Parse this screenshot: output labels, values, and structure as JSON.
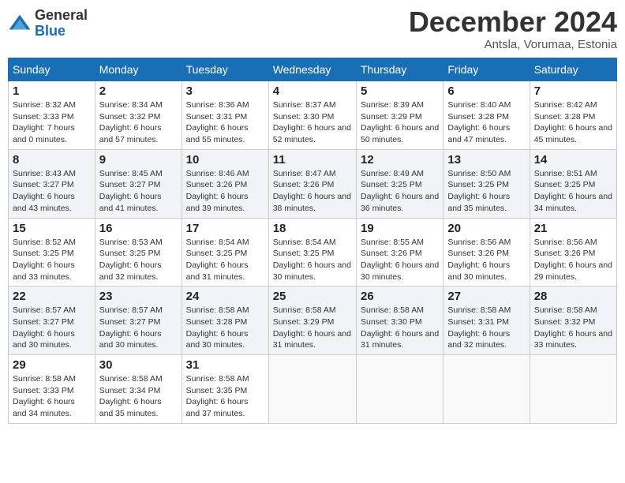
{
  "header": {
    "logo_general": "General",
    "logo_blue": "Blue",
    "month_title": "December 2024",
    "location": "Antsla, Vorumaa, Estonia"
  },
  "days_of_week": [
    "Sunday",
    "Monday",
    "Tuesday",
    "Wednesday",
    "Thursday",
    "Friday",
    "Saturday"
  ],
  "weeks": [
    [
      {
        "day": "1",
        "sunrise": "8:32 AM",
        "sunset": "3:33 PM",
        "daylight": "7 hours and 0 minutes."
      },
      {
        "day": "2",
        "sunrise": "8:34 AM",
        "sunset": "3:32 PM",
        "daylight": "6 hours and 57 minutes."
      },
      {
        "day": "3",
        "sunrise": "8:36 AM",
        "sunset": "3:31 PM",
        "daylight": "6 hours and 55 minutes."
      },
      {
        "day": "4",
        "sunrise": "8:37 AM",
        "sunset": "3:30 PM",
        "daylight": "6 hours and 52 minutes."
      },
      {
        "day": "5",
        "sunrise": "8:39 AM",
        "sunset": "3:29 PM",
        "daylight": "6 hours and 50 minutes."
      },
      {
        "day": "6",
        "sunrise": "8:40 AM",
        "sunset": "3:28 PM",
        "daylight": "6 hours and 47 minutes."
      },
      {
        "day": "7",
        "sunrise": "8:42 AM",
        "sunset": "3:28 PM",
        "daylight": "6 hours and 45 minutes."
      }
    ],
    [
      {
        "day": "8",
        "sunrise": "8:43 AM",
        "sunset": "3:27 PM",
        "daylight": "6 hours and 43 minutes."
      },
      {
        "day": "9",
        "sunrise": "8:45 AM",
        "sunset": "3:27 PM",
        "daylight": "6 hours and 41 minutes."
      },
      {
        "day": "10",
        "sunrise": "8:46 AM",
        "sunset": "3:26 PM",
        "daylight": "6 hours and 39 minutes."
      },
      {
        "day": "11",
        "sunrise": "8:47 AM",
        "sunset": "3:26 PM",
        "daylight": "6 hours and 38 minutes."
      },
      {
        "day": "12",
        "sunrise": "8:49 AM",
        "sunset": "3:25 PM",
        "daylight": "6 hours and 36 minutes."
      },
      {
        "day": "13",
        "sunrise": "8:50 AM",
        "sunset": "3:25 PM",
        "daylight": "6 hours and 35 minutes."
      },
      {
        "day": "14",
        "sunrise": "8:51 AM",
        "sunset": "3:25 PM",
        "daylight": "6 hours and 34 minutes."
      }
    ],
    [
      {
        "day": "15",
        "sunrise": "8:52 AM",
        "sunset": "3:25 PM",
        "daylight": "6 hours and 33 minutes."
      },
      {
        "day": "16",
        "sunrise": "8:53 AM",
        "sunset": "3:25 PM",
        "daylight": "6 hours and 32 minutes."
      },
      {
        "day": "17",
        "sunrise": "8:54 AM",
        "sunset": "3:25 PM",
        "daylight": "6 hours and 31 minutes."
      },
      {
        "day": "18",
        "sunrise": "8:54 AM",
        "sunset": "3:25 PM",
        "daylight": "6 hours and 30 minutes."
      },
      {
        "day": "19",
        "sunrise": "8:55 AM",
        "sunset": "3:26 PM",
        "daylight": "6 hours and 30 minutes."
      },
      {
        "day": "20",
        "sunrise": "8:56 AM",
        "sunset": "3:26 PM",
        "daylight": "6 hours and 30 minutes."
      },
      {
        "day": "21",
        "sunrise": "8:56 AM",
        "sunset": "3:26 PM",
        "daylight": "6 hours and 29 minutes."
      }
    ],
    [
      {
        "day": "22",
        "sunrise": "8:57 AM",
        "sunset": "3:27 PM",
        "daylight": "6 hours and 30 minutes."
      },
      {
        "day": "23",
        "sunrise": "8:57 AM",
        "sunset": "3:27 PM",
        "daylight": "6 hours and 30 minutes."
      },
      {
        "day": "24",
        "sunrise": "8:58 AM",
        "sunset": "3:28 PM",
        "daylight": "6 hours and 30 minutes."
      },
      {
        "day": "25",
        "sunrise": "8:58 AM",
        "sunset": "3:29 PM",
        "daylight": "6 hours and 31 minutes."
      },
      {
        "day": "26",
        "sunrise": "8:58 AM",
        "sunset": "3:30 PM",
        "daylight": "6 hours and 31 minutes."
      },
      {
        "day": "27",
        "sunrise": "8:58 AM",
        "sunset": "3:31 PM",
        "daylight": "6 hours and 32 minutes."
      },
      {
        "day": "28",
        "sunrise": "8:58 AM",
        "sunset": "3:32 PM",
        "daylight": "6 hours and 33 minutes."
      }
    ],
    [
      {
        "day": "29",
        "sunrise": "8:58 AM",
        "sunset": "3:33 PM",
        "daylight": "6 hours and 34 minutes."
      },
      {
        "day": "30",
        "sunrise": "8:58 AM",
        "sunset": "3:34 PM",
        "daylight": "6 hours and 35 minutes."
      },
      {
        "day": "31",
        "sunrise": "8:58 AM",
        "sunset": "3:35 PM",
        "daylight": "6 hours and 37 minutes."
      },
      null,
      null,
      null,
      null
    ]
  ],
  "labels": {
    "sunrise": "Sunrise: ",
    "sunset": "Sunset: ",
    "daylight": "Daylight: "
  }
}
